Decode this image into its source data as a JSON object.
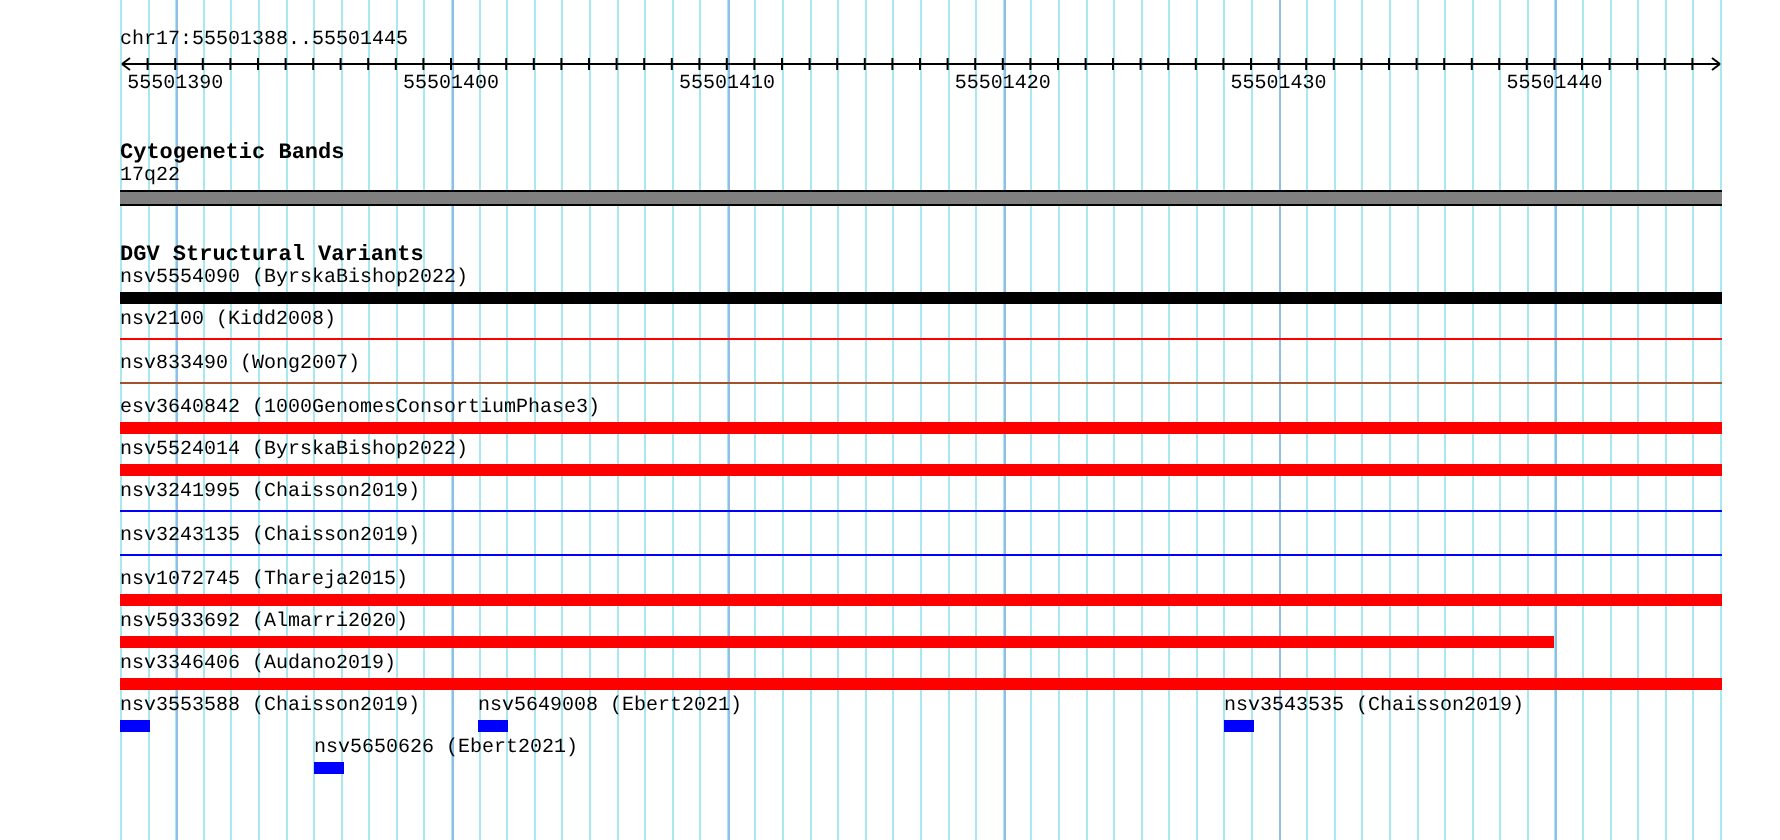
{
  "location": "chr17:55501388..55501445",
  "ruler": {
    "ticks": [
      "55501390",
      "55501400",
      "55501410",
      "55501420",
      "55501430",
      "55501440"
    ]
  },
  "bands_track": {
    "title": "Cytogenetic Bands",
    "band": {
      "label": "17q22"
    }
  },
  "variants_track": {
    "title": "DGV Structural Variants",
    "features": [
      {
        "label": "nsv5554090 (ByrskaBishop2022)",
        "kind": "thick",
        "color": "#000000"
      },
      {
        "label": "nsv2100 (Kidd2008)",
        "kind": "thin",
        "color": "#ff0000"
      },
      {
        "label": "nsv833490 (Wong2007)",
        "kind": "thin",
        "color": "#a0522d"
      },
      {
        "label": "esv3640842 (1000GenomesConsortiumPhase3)",
        "kind": "thick",
        "color": "#ff0000"
      },
      {
        "label": "nsv5524014 (ByrskaBishop2022)",
        "kind": "thick",
        "color": "#ff0000"
      },
      {
        "label": "nsv3241995 (Chaisson2019)",
        "kind": "thin",
        "color": "#0000ff"
      },
      {
        "label": "nsv3243135 (Chaisson2019)",
        "kind": "thin",
        "color": "#0000ff"
      },
      {
        "label": "nsv1072745 (Thareja2015)",
        "kind": "thick",
        "color": "#ff0000"
      },
      {
        "label": "nsv5933692 (Almarri2020)",
        "kind": "partial",
        "color": "#ff0000"
      },
      {
        "label": "nsv3346406 (Audano2019)",
        "kind": "thick",
        "color": "#ff0000"
      }
    ],
    "packed_rows": [
      [
        {
          "label": "nsv3553588 (Chaisson2019)",
          "color": "#0000ff"
        },
        {
          "label": "nsv5649008 (Ebert2021)",
          "color": "#0000ff"
        },
        {
          "label": "nsv3543535 (Chaisson2019)",
          "color": "#0000ff"
        }
      ],
      [
        {
          "label": "nsv5650626 (Ebert2021)",
          "color": "#0000ff"
        }
      ]
    ]
  }
}
